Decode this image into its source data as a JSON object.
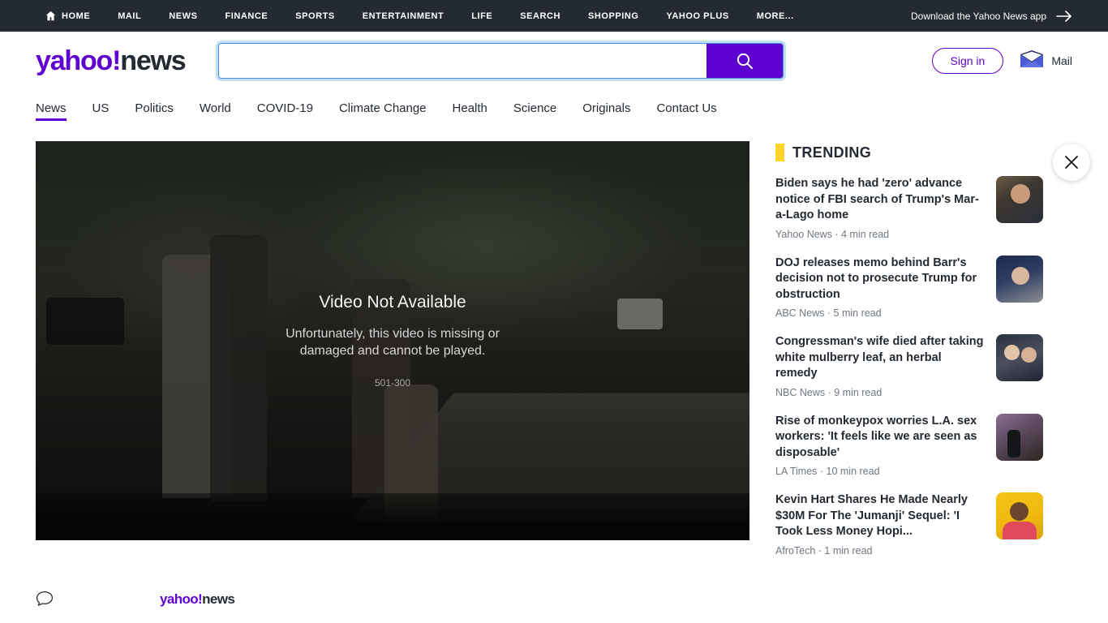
{
  "universal_header": {
    "items": [
      {
        "label": "HOME",
        "icon": "home-icon",
        "active": false
      },
      {
        "label": "MAIL",
        "active": false
      },
      {
        "label": "NEWS",
        "active": true
      },
      {
        "label": "FINANCE",
        "active": false
      },
      {
        "label": "SPORTS",
        "active": false
      },
      {
        "label": "ENTERTAINMENT",
        "active": false
      },
      {
        "label": "LIFE",
        "active": false
      },
      {
        "label": "SEARCH",
        "active": false
      },
      {
        "label": "SHOPPING",
        "active": false
      },
      {
        "label": "YAHOO PLUS",
        "active": false
      },
      {
        "label": "MORE...",
        "active": false
      }
    ],
    "download_label": "Download the Yahoo News app"
  },
  "masthead": {
    "logo_brand": "yahoo!",
    "logo_property": "news",
    "search": {
      "value": "",
      "placeholder": ""
    },
    "sign_in_label": "Sign in",
    "mail_label": "Mail"
  },
  "section_nav": {
    "items": [
      {
        "label": "News",
        "active": true
      },
      {
        "label": "US",
        "active": false
      },
      {
        "label": "Politics",
        "active": false
      },
      {
        "label": "World",
        "active": false
      },
      {
        "label": "COVID-19",
        "active": false
      },
      {
        "label": "Climate Change",
        "active": false
      },
      {
        "label": "Health",
        "active": false
      },
      {
        "label": "Science",
        "active": false
      },
      {
        "label": "Originals",
        "active": false
      },
      {
        "label": "Contact Us",
        "active": false
      }
    ]
  },
  "player": {
    "error_title": "Video Not Available",
    "error_message": "Unfortunately, this video is missing or damaged and cannot be played.",
    "error_code": "501-300"
  },
  "trending": {
    "heading": "TRENDING",
    "marker_color": "#ffd426",
    "items": [
      {
        "title": "Biden says he had 'zero' advance notice of FBI search of Trump's Mar-a-Lago home",
        "source": "Yahoo News",
        "read_time": "4 min read",
        "meta": "Yahoo News · 4 min read"
      },
      {
        "title": "DOJ releases memo behind Barr's decision not to prosecute Trump for obstruction",
        "source": "ABC News",
        "read_time": "5 min read",
        "meta": "ABC News · 5 min read"
      },
      {
        "title": "Congressman's wife died after taking white mulberry leaf, an herbal remedy",
        "source": "NBC News",
        "read_time": "9 min read",
        "meta": "NBC News · 9 min read"
      },
      {
        "title": "Rise of monkeypox worries L.A. sex workers: 'It feels like we are seen as disposable'",
        "source": "LA Times",
        "read_time": "10 min read",
        "meta": "LA Times · 10 min read"
      },
      {
        "title": "Kevin Hart Shares He Made Nearly $30M For The 'Jumanji' Sequel: 'I Took Less Money Hopi...",
        "source": "AfroTech",
        "read_time": "1 min read",
        "meta": "AfroTech · 1 min read"
      }
    ]
  },
  "footer_strip": {
    "logo_brand": "yahoo!",
    "logo_property": "news"
  },
  "colors": {
    "purple": "#5f01d1",
    "dark": "#232a31",
    "yellow": "#ffd426",
    "focus_blue": "#3e91e3"
  }
}
